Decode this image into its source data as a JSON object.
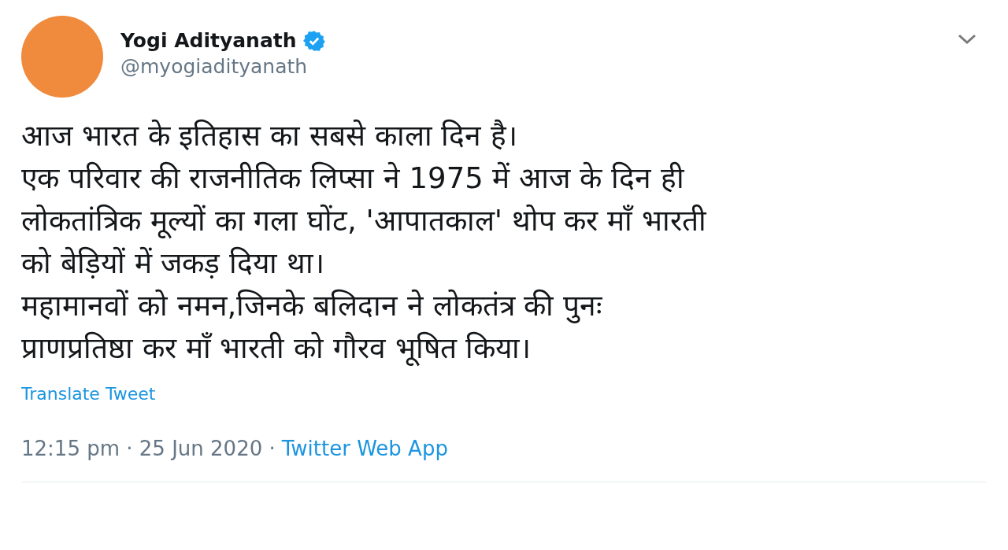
{
  "author": {
    "name": "Yogi Adityanath",
    "verified": true,
    "handle": "@myogiadityanath"
  },
  "body_lines": [
    "आज भारत के इतिहास का सबसे काला दिन है।",
    "एक परिवार की राजनीतिक लिप्सा ने 1975 में आज के दिन ही",
    "लोकतांत्रिक मूल्यों का गला घोंट, 'आपातकाल' थोप कर माँ भारती",
    "को बेड़ियों में जकड़ दिया था।",
    "महामानवों को नमन,जिनके बलिदान ने लोकतंत्र की पुनः",
    "प्राणप्रतिष्ठा कर माँ भारती को गौरव भूषित किया।"
  ],
  "translate_link": "Translate Tweet",
  "meta": {
    "time_and_date": "12:15 pm · 25 Jun 2020 ·",
    "source": "Twitter Web App"
  }
}
